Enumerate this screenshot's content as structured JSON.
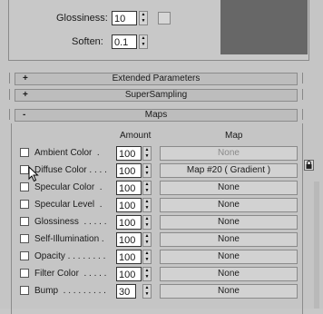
{
  "shader": {
    "glossiness_label": "Glossiness:",
    "glossiness_value": "10",
    "soften_label": "Soften:",
    "soften_value": "0.1"
  },
  "rollouts": [
    {
      "sign": "+",
      "title": "Extended Parameters"
    },
    {
      "sign": "+",
      "title": "SuperSampling"
    },
    {
      "sign": "-",
      "title": "Maps"
    }
  ],
  "maps": {
    "col_amount": "Amount",
    "col_map": "Map",
    "rows": [
      {
        "label": "Ambient Color  .",
        "amount": "100",
        "map": "None",
        "faded": true
      },
      {
        "label": "Diffuse Color . . . .",
        "amount": "100",
        "map": "Map #20  ( Gradient )",
        "faded": false
      },
      {
        "label": "Specular Color  .",
        "amount": "100",
        "map": "None",
        "faded": false
      },
      {
        "label": "Specular Level  .",
        "amount": "100",
        "map": "None",
        "faded": false
      },
      {
        "label": "Glossiness  . . . . .",
        "amount": "100",
        "map": "None",
        "faded": false
      },
      {
        "label": "Self-Illumination .",
        "amount": "100",
        "map": "None",
        "faded": false
      },
      {
        "label": "Opacity . . . . . . . .",
        "amount": "100",
        "map": "None",
        "faded": false
      },
      {
        "label": "Filter Color  . . . . .",
        "amount": "100",
        "map": "None",
        "faded": false
      },
      {
        "label": "Bump  . . . . . . . . .",
        "amount": "30",
        "map": "None",
        "faded": false
      }
    ]
  },
  "icons": {
    "lock": "lock-icon",
    "cursor": "mouse-pointer-icon"
  },
  "colors": {
    "swatch": "#676767",
    "panel": "#c5c5c5"
  }
}
